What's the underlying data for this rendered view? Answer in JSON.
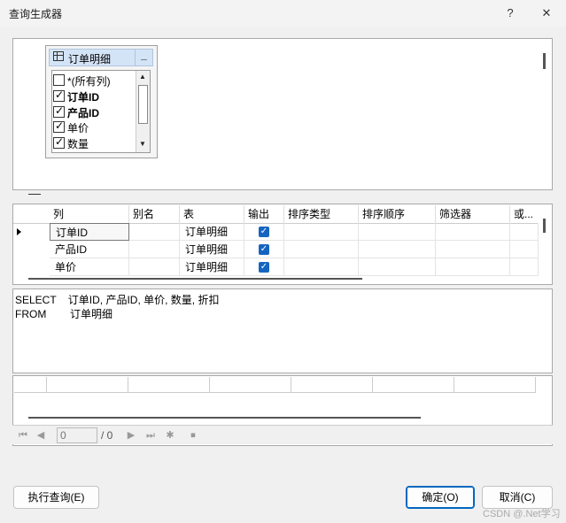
{
  "window": {
    "title": "查询生成器",
    "help_label": "?",
    "close_label": "✕"
  },
  "diagram": {
    "table_name": "订单明细",
    "minimize_label": "_",
    "columns": [
      {
        "label": "*(所有列)",
        "checked": false
      },
      {
        "label": "订单ID",
        "checked": true
      },
      {
        "label": "产品ID",
        "checked": true
      },
      {
        "label": "单价",
        "checked": true
      },
      {
        "label": "数量",
        "checked": true
      }
    ]
  },
  "grid": {
    "headers": [
      "列",
      "别名",
      "表",
      "输出",
      "排序类型",
      "排序顺序",
      "筛选器",
      "或..."
    ],
    "rows": [
      {
        "column": "订单ID",
        "alias": "",
        "table": "订单明细",
        "output": true
      },
      {
        "column": "产品ID",
        "alias": "",
        "table": "订单明细",
        "output": true
      },
      {
        "column": "单价",
        "alias": "",
        "table": "订单明细",
        "output": true
      }
    ]
  },
  "sql": {
    "line1": "SELECT    订单ID, 产品ID, 单价, 数量, 折扣",
    "line2": "FROM        订单明细"
  },
  "navigator": {
    "current_page": "0",
    "total": "/ 0"
  },
  "buttons": {
    "execute": "执行查询(E)",
    "ok": "确定(O)",
    "cancel": "取消(C)"
  },
  "watermark": "CSDN @.Net学习"
}
